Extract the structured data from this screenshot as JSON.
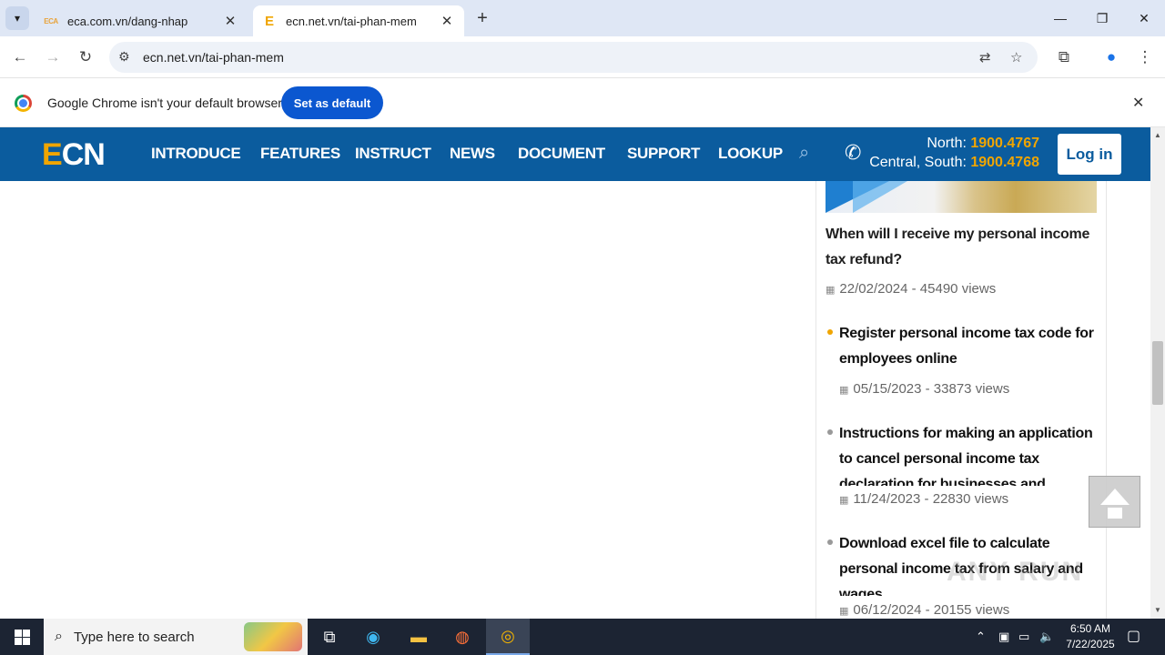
{
  "tabs": [
    {
      "favicon": "ECA",
      "title": "eca.com.vn/dang-nhap"
    },
    {
      "favicon": "E",
      "title": "ecn.net.vn/tai-phan-mem"
    }
  ],
  "toolbar": {
    "url": "ecn.net.vn/tai-phan-mem"
  },
  "infobar": {
    "message": "Google Chrome isn't your default browser",
    "button": "Set as default"
  },
  "site": {
    "logo_e": "E",
    "logo_rest": "CN",
    "nav": [
      "INTRODUCE",
      "FEATURES",
      "INSTRUCT",
      "NEWS",
      "DOCUMENT",
      "SUPPORT",
      "LOOKUP"
    ],
    "hotline": {
      "north_label": "North: ",
      "north_number": "1900.4767",
      "central_label": "Central, South: ",
      "central_number": "1900.4768"
    },
    "login": "Log in"
  },
  "sidebar": {
    "featured": {
      "title": "When will I receive my personal income tax refund?",
      "meta": "22/02/2024 - 45490 views"
    },
    "articles": [
      {
        "title": "Register personal income tax code for employees online",
        "meta": "05/15/2023 - 33873 views",
        "bullet_color": "#f0a500"
      },
      {
        "title": "Instructions for making an application to cancel personal income tax declaration for businesses and",
        "meta": "11/24/2023 - 22830 views",
        "bullet_color": "#999999"
      },
      {
        "title": "Download excel file to calculate personal income tax from salary and wages",
        "meta": "06/12/2024 - 20155 views",
        "bullet_color": "#999999"
      }
    ]
  },
  "watermark": "ANY RUN",
  "taskbar": {
    "search_placeholder": "Type here to search",
    "time": "6:50 AM",
    "date": "7/22/2025"
  },
  "colors": {
    "header_blue": "#0b5c9e",
    "accent_orange": "#f0a500",
    "chrome_blue": "#0b57d0"
  }
}
